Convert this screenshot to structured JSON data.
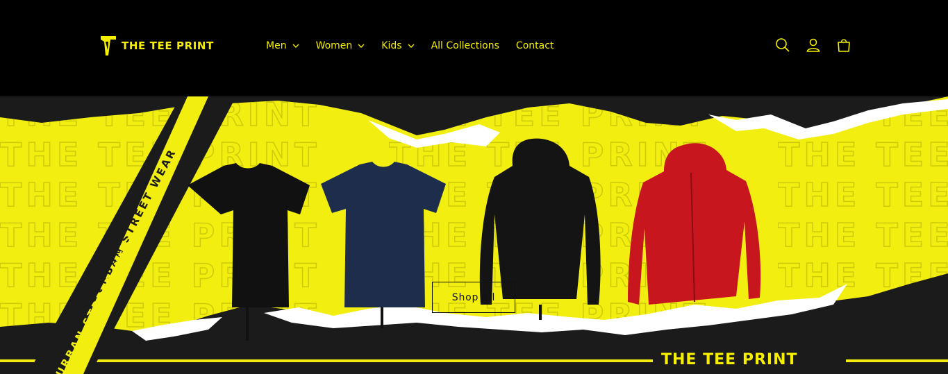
{
  "brand": {
    "name": "THE TEE PRINT",
    "logo_icon": "tee-print-logo-icon",
    "accent_color": "#f6f000"
  },
  "nav": {
    "items": [
      {
        "label": "Men",
        "has_dropdown": true
      },
      {
        "label": "Women",
        "has_dropdown": true
      },
      {
        "label": "Kids",
        "has_dropdown": true
      },
      {
        "label": "All Collections",
        "has_dropdown": false
      },
      {
        "label": "Contact",
        "has_dropdown": false
      }
    ]
  },
  "header_icons": [
    "search-icon",
    "account-icon",
    "cart-icon"
  ],
  "hero": {
    "shop_label": "Shop all",
    "banner_brand": "THE TEE PRINT",
    "tape_text": "URBAN STREET WEAR",
    "background_text": "THE TEE PRINT",
    "colors": {
      "yellow": "#f2ef10",
      "dark": "#1b1b1b",
      "shirt_black": "#111111",
      "shirt_navy": "#1f2d4d",
      "hoodie_black": "#141414",
      "hoodie_red": "#c8161f"
    }
  }
}
